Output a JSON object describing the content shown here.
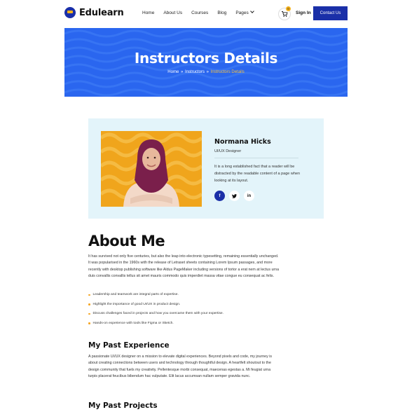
{
  "header": {
    "logo": "Edulearn",
    "nav": [
      "Home",
      "About Us",
      "Courses",
      "Blog",
      "Pages"
    ],
    "cart_count": "0",
    "signin": "Sign In",
    "contact": "Contact Us"
  },
  "banner": {
    "title": "Instructors Details",
    "breadcrumb": [
      "Home",
      "Instructors",
      "Instructors Details"
    ],
    "separator": "»"
  },
  "instructor": {
    "name": "Normana Hicks",
    "role": "UI/UX Designer",
    "bio": "It is a long established fact that a reader will be distracted by the readable content of a page when looking at its layout.",
    "socials": [
      {
        "name": "facebook-icon",
        "glyph": "f"
      },
      {
        "name": "twitter-icon",
        "glyph": "t"
      },
      {
        "name": "linkedin-icon",
        "glyph": "in"
      }
    ]
  },
  "about": {
    "title": "About Me",
    "text": "It has survived not only five centuries, but also the leap into electronic typesetting, remaining essentially unchanged. It was popularised in the 1960s with the release of Letraset sheets containing Lorem Ipsum passages, and more recently with desktop publishing software like Aldus PageMaker including versions of tortor a erat nem at lectus urna duis convallis convallis tellus sit amet mauris commodo quis imperdiet massa vitae congue eu consequat ac felis.",
    "bullets": [
      "Leadership and teamwork are integral parts of expertise.",
      "Highlight the importance of good UI/UX in product design.",
      "Discuss challenges faced in projects and how you overcame them with your expertise.",
      "Hands-on experience with tools like Figma or Sketch."
    ]
  },
  "experience": {
    "title": "My Past Experience",
    "text": "A passionate UI/UX designer on a mission to elevate digital experiences. Beyond pixels and code, my journey is about creating connections between users and technology through thoughtful design. A heartfelt shoutout to the design community that fuels my creativity. Pellentesque morbi consequat, maecenas egestas a. Mi feugiat urna turpis placerat feucibus bibendum hac vulputate. Elit lacus accumsan nullam semper gravida nunc."
  },
  "projects": {
    "title": "My Past Projects"
  }
}
